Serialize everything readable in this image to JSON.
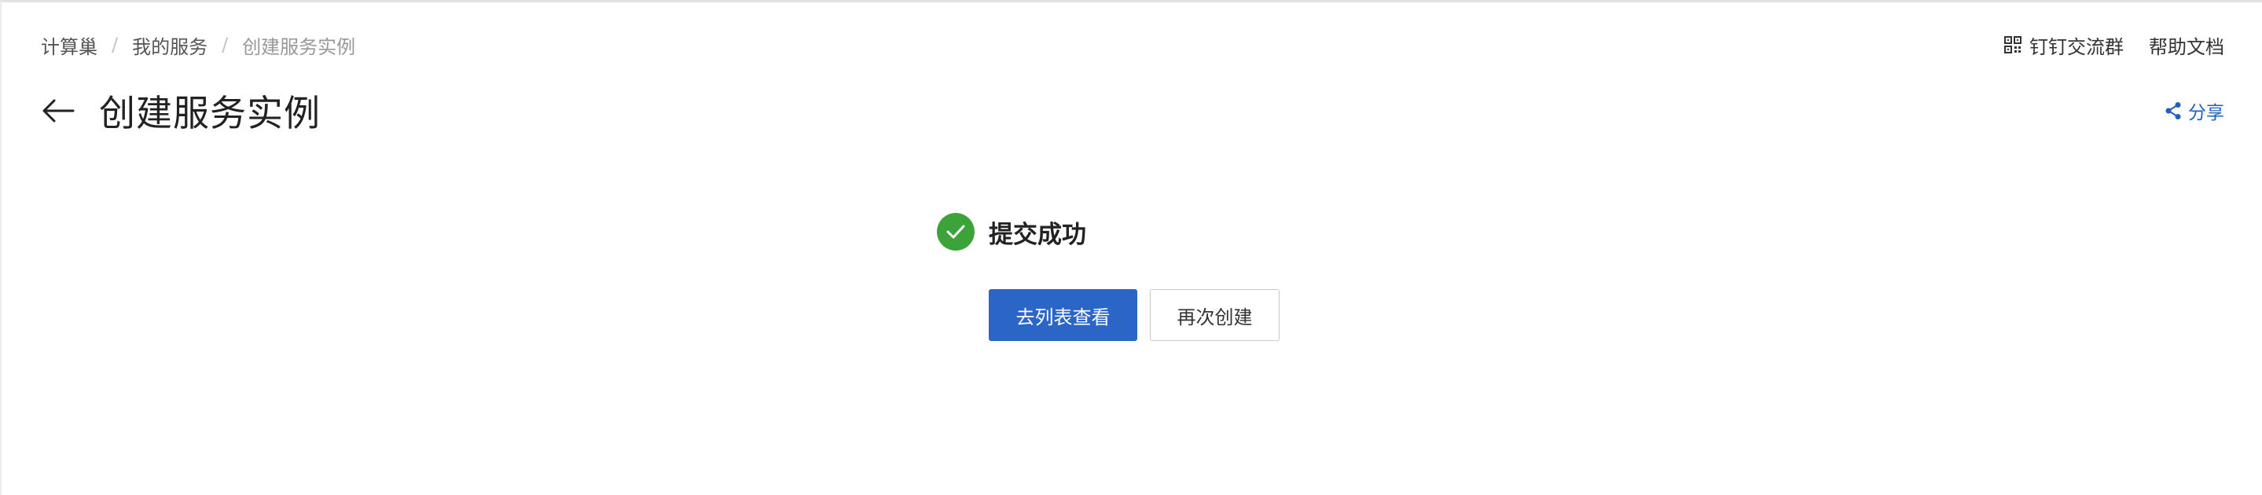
{
  "breadcrumb": {
    "items": [
      "计算巢",
      "我的服务",
      "创建服务实例"
    ],
    "separator": "/"
  },
  "top_links": {
    "dingtalk_label": "钉钉交流群",
    "help_label": "帮助文档"
  },
  "header": {
    "title": "创建服务实例",
    "share_label": "分享"
  },
  "result": {
    "status_text": "提交成功",
    "status_color": "#3ba33a"
  },
  "actions": {
    "primary_label": "去列表查看",
    "secondary_label": "再次创建"
  },
  "colors": {
    "accent": "#2b66c7",
    "link": "#1f5fbf",
    "success": "#3ba33a"
  },
  "icons": {
    "back": "arrow-left-icon",
    "qr": "qrcode-icon",
    "share": "share-icon",
    "success": "check-circle-icon"
  }
}
